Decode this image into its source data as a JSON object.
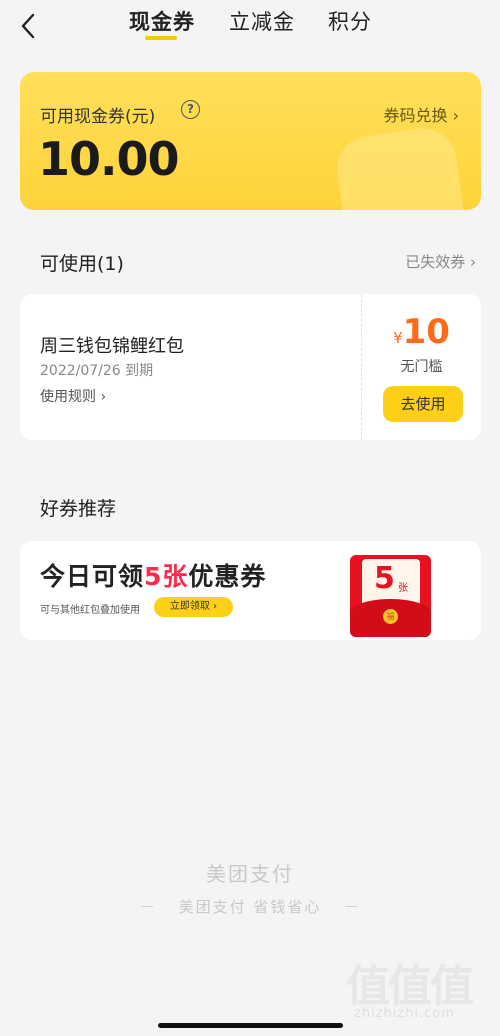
{
  "header": {
    "back_icon": "chevron-left-icon",
    "tabs": [
      {
        "label": "现金券",
        "active": true
      },
      {
        "label": "立减金",
        "active": false
      },
      {
        "label": "积分",
        "active": false
      }
    ],
    "accent_color": "#f7c700"
  },
  "balance": {
    "label": "可用现金券(元)",
    "help_icon": "question-circle-icon",
    "help_glyph": "?",
    "redeem_link": "券码兑换",
    "amount": "10.00",
    "card_color": "#fdd33a"
  },
  "usable": {
    "title": "可使用(1)",
    "expired_link": "已失效券",
    "coupons": [
      {
        "name": "周三钱包锦鲤红包",
        "expiry": "2022/07/26 到期",
        "rules_link": "使用规则",
        "currency": "¥",
        "value": "10",
        "threshold": "无门槛",
        "button": "去使用"
      }
    ],
    "value_color": "#ff6a1a",
    "button_color": "#fdd017"
  },
  "recommend": {
    "title": "好券推荐",
    "promo": {
      "headline_prefix": "今日可领",
      "headline_highlight": "5张",
      "headline_suffix": "优惠券",
      "subtext": "可与其他红包叠加使用",
      "button": "立即领取",
      "envelope_number": "5",
      "envelope_unit": "张",
      "envelope_seal": "福",
      "highlight_color": "#ff2a4a"
    }
  },
  "footer": {
    "brand": "美团支付",
    "slogan": "美团支付 省钱省心"
  },
  "watermark": {
    "chars": "值值值",
    "url": "zhizhizhi.com"
  }
}
